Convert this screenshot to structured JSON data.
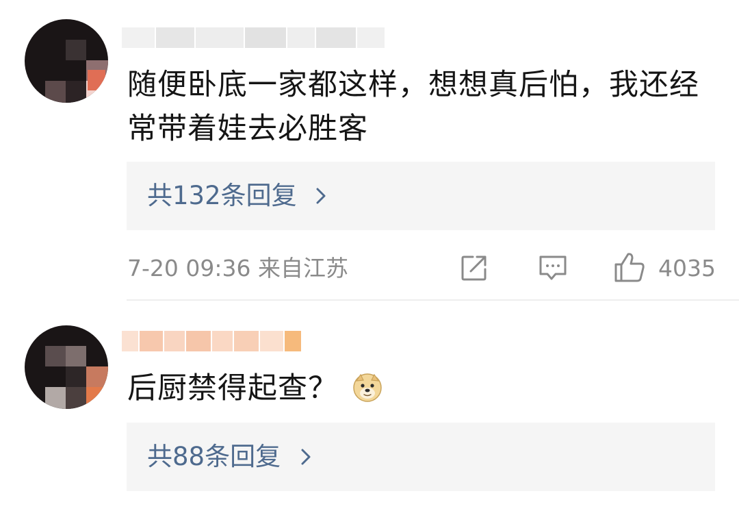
{
  "comments": [
    {
      "text_line1": "随便卧底一家都这样，想想真后怕，我还经",
      "text_line2": "常带着娃去必胜客",
      "replies_label": "共132条回复",
      "time_location": "7-20 09:36 来自江苏",
      "likes": "4035"
    },
    {
      "text": "后厨禁得起查？",
      "emoji": "doge-emoji",
      "replies_label": "共88条回复"
    }
  ],
  "icons": {
    "share": "share-icon",
    "comment": "comment-icon",
    "like": "thumbs-up-icon",
    "chevron": "chevron-right-icon"
  },
  "colors": {
    "link": "#4e6a8e",
    "meta": "#8a8a8a",
    "text": "#151515",
    "reply_bg": "#f5f5f5"
  }
}
